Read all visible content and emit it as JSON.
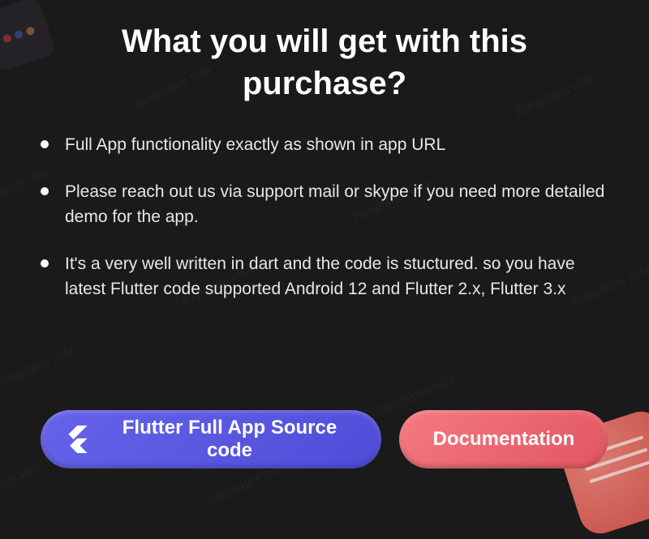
{
  "heading": "What you will get with this purchase?",
  "items": [
    "Full App functionality exactly as shown in app URL",
    "Please reach out us via support mail or skype if you need more detailed demo for the app.",
    "It's a very well written in dart and the code is stuctured. so you have latest Flutter code supported Android 12 and Flutter 2.x, Flutter 3.x"
  ],
  "buttons": {
    "primary": "Flutter Full App Source code",
    "secondary": "Documentation"
  },
  "watermark": "Templates villa"
}
